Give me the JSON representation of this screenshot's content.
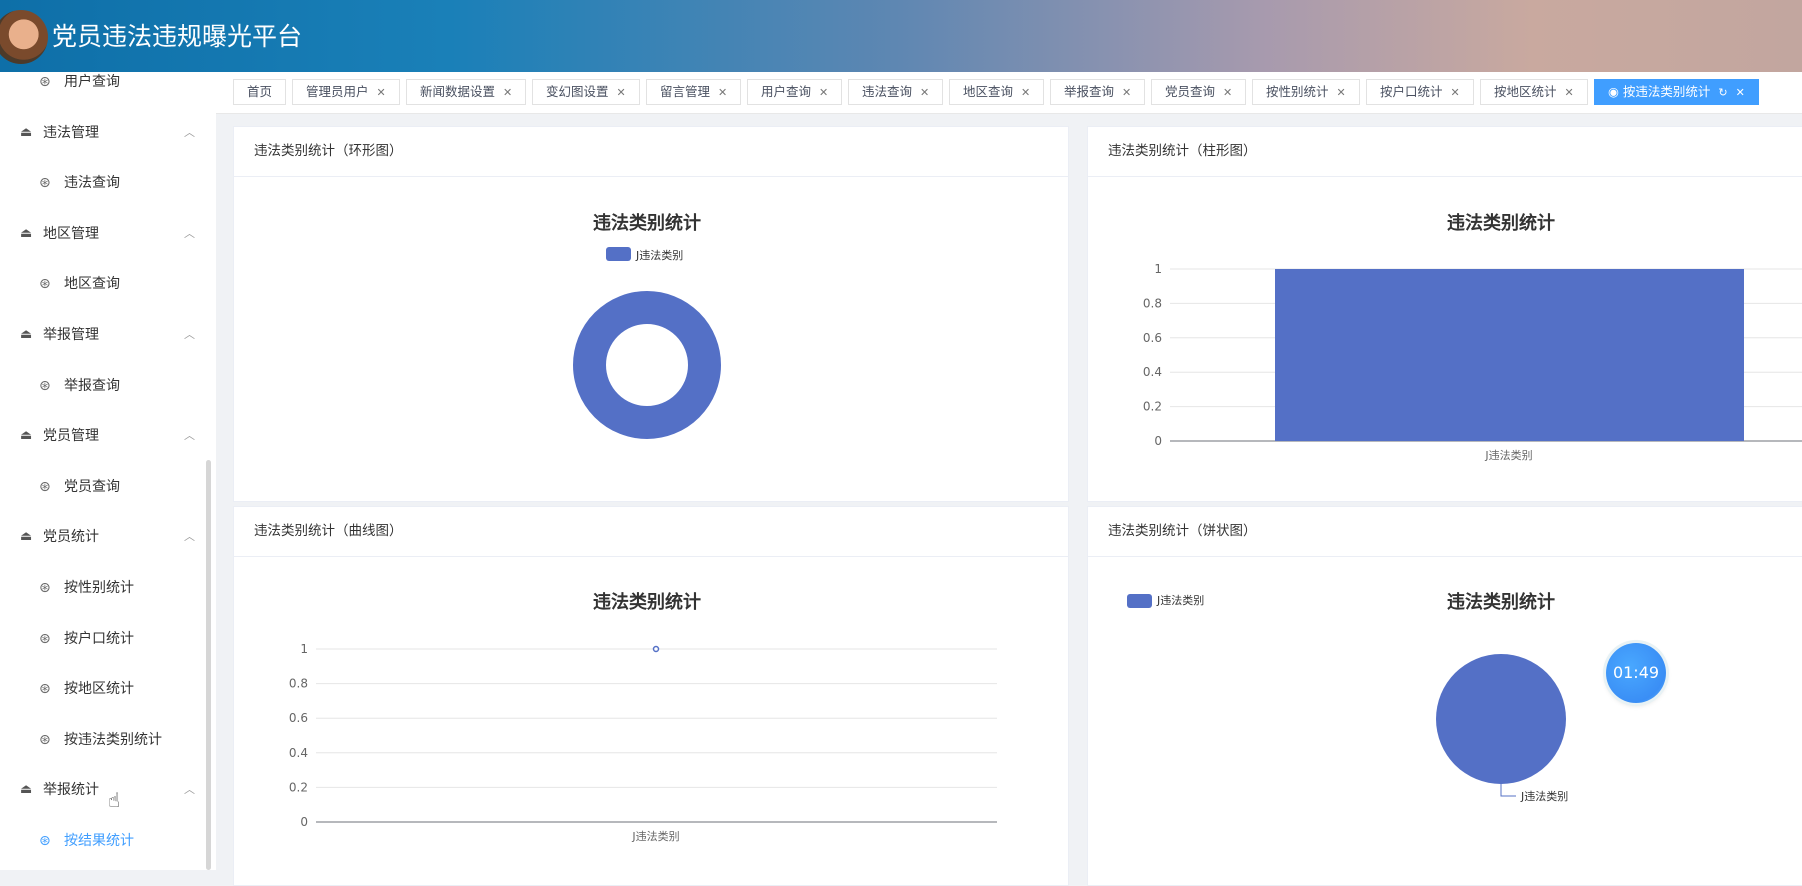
{
  "header": {
    "title": "党员违法违规曝光平台"
  },
  "sidebar": {
    "groups": [
      {
        "label": "违法管理",
        "items": [
          "违法查询"
        ]
      },
      {
        "label": "地区管理",
        "items": [
          "地区查询"
        ]
      },
      {
        "label": "举报管理",
        "items": [
          "举报查询"
        ]
      },
      {
        "label": "党员管理",
        "items": [
          "党员查询"
        ]
      },
      {
        "label": "党员统计",
        "items": [
          "按性别统计",
          "按户口统计",
          "按地区统计",
          "按违法类别统计"
        ]
      },
      {
        "label": "举报统计",
        "items": [
          "按结果统计"
        ]
      }
    ],
    "top_item": "用户查询",
    "active_item": "按结果统计"
  },
  "tabs": [
    "首页",
    "管理员用户",
    "新闻数据设置",
    "变幻图设置",
    "留言管理",
    "用户查询",
    "违法查询",
    "地区查询",
    "举报查询",
    "党员查询",
    "按性别统计",
    "按户口统计",
    "按地区统计",
    "按违法类别统计"
  ],
  "active_tab": "按违法类别统计",
  "panels": {
    "donut": "违法类别统计（环形图）",
    "bar": "违法类别统计（柱形图）",
    "line": "违法类别统计（曲线图）",
    "pie": "违法类别统计（饼状图）"
  },
  "timer": "01:49",
  "colors": {
    "series": "#5470c6",
    "accent": "#409eff"
  },
  "chart_data": [
    {
      "type": "pie",
      "variant": "donut",
      "title": "违法类别统计",
      "legend": [
        "J违法类别"
      ],
      "legend_position": "top",
      "categories": [
        "J违法类别"
      ],
      "values": [
        1
      ]
    },
    {
      "type": "bar",
      "title": "违法类别统计",
      "categories": [
        "J违法类别"
      ],
      "values": [
        1
      ],
      "ylim": [
        0,
        1
      ],
      "yticks": [
        "0",
        "0.2",
        "0.4",
        "0.6",
        "0.8",
        "1"
      ]
    },
    {
      "type": "line",
      "title": "违法类别统计",
      "categories": [
        "J违法类别"
      ],
      "values": [
        1
      ],
      "ylim": [
        0,
        1
      ],
      "yticks": [
        "0",
        "0.2",
        "0.4",
        "0.6",
        "0.8",
        "1"
      ]
    },
    {
      "type": "pie",
      "title": "违法类别统计",
      "legend": [
        "J违法类别"
      ],
      "legend_position": "top-left",
      "categories": [
        "J违法类别"
      ],
      "values": [
        1
      ],
      "labels": [
        "J违法类别"
      ]
    }
  ]
}
